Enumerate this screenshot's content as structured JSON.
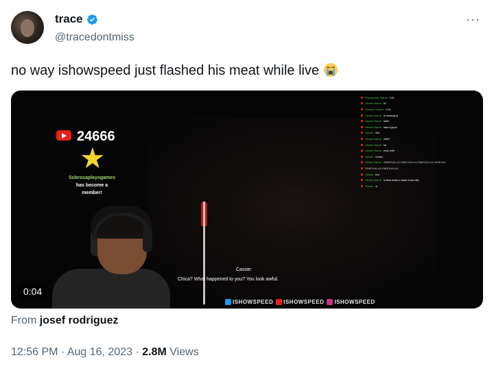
{
  "author": {
    "display_name": "trace",
    "handle": "@tracedontmiss",
    "verified": true
  },
  "more_label": "···",
  "tweet": {
    "text": "no way ishowspeed just flashed his meat while live",
    "emoji": "loudly-crying-face-emoji"
  },
  "video": {
    "subscriber_count": "24666",
    "member_alert": {
      "name": "Subrosaplaysgames",
      "line1": "has become a",
      "line2": "member!"
    },
    "subtitle_speaker": "Cassie:",
    "subtitle_text": "Chica? What happened to you? You look awful.",
    "overlay_socials": [
      {
        "platform": "twitter",
        "label": "ISHOWSPEED",
        "color": "#1d9bf0"
      },
      {
        "platform": "youtube",
        "label": "ISHOWSPEED",
        "color": "#e62117"
      },
      {
        "platform": "instagram",
        "label": "ISHOWSPEED",
        "color": "#c13584"
      }
    ],
    "chat_rows": [
      {
        "name": "Placeholder Name",
        "msg": "LOL"
      },
      {
        "name": "Viewer Name",
        "msg": "W"
      },
      {
        "name": "Another Viewer",
        "msg": "LOL"
      },
      {
        "name": "Viewer Name",
        "msg": "a newbrand"
      },
      {
        "name": "Viewer Name",
        "msg": "WAY"
      },
      {
        "name": "Viewer Name",
        "msg": "stand good"
      },
      {
        "name": "Viewer",
        "msg": "Wo"
      },
      {
        "name": "Viewer Name",
        "msg": "WAIT"
      },
      {
        "name": "Viewer Name",
        "msg": "lol"
      },
      {
        "name": "Viewer Name",
        "msg": "ruby with"
      },
      {
        "name": "Viewer",
        "msg": "cream"
      },
      {
        "name": "Viewer Name",
        "msg": "OMEGALULOMEGALULOMEGALULOMEGA",
        "link": true
      },
      {
        "name": "",
        "msg": "OMEGALULOMEGALUL",
        "link": true
      },
      {
        "name": "Viewer",
        "msg": "bro"
      },
      {
        "name": "Viewer Name",
        "msg": "is that what ur flash looks like"
      },
      {
        "name": "Viewer",
        "msg": "w"
      }
    ],
    "timestamp": "0:04",
    "theme_colors": {
      "chat_name": "#48c04a",
      "alert_name": "#9fd776",
      "star": "#f3d431"
    }
  },
  "source": {
    "prefix": "From",
    "name": "josef rodriguez"
  },
  "meta": {
    "time": "12:56 PM",
    "separator": "·",
    "date": "Aug 16, 2023",
    "views_count": "2.8M",
    "views_label": "Views"
  },
  "colors": {
    "text_primary": "#0f1419",
    "text_secondary": "#536471",
    "verified_blue": "#1d9bf0"
  }
}
